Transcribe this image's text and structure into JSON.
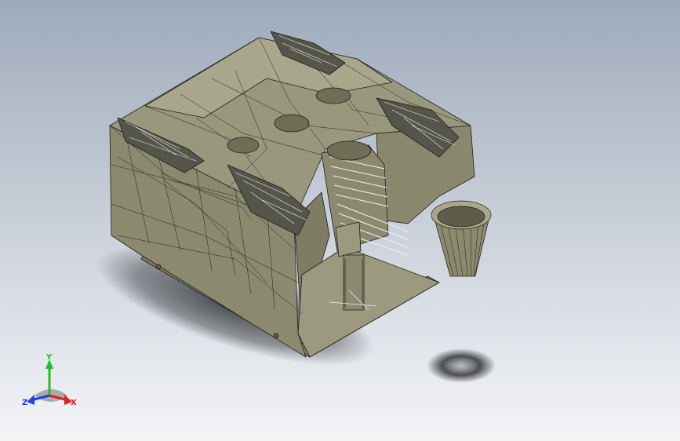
{
  "viewport": {
    "background_top": "#9eaabb",
    "background_bottom": "#f4f5f7",
    "model_color": "#8c8a6e",
    "model_dark": "#6f6d55",
    "model_light": "#a9a78b",
    "edge_color": "#1e1e1e",
    "shadow_color": "#2b2d30"
  },
  "triad": {
    "x_label": "X",
    "y_label": "Y",
    "z_label": "Z",
    "x_color": "#e02020",
    "y_color": "#20c020",
    "z_color": "#2040e0"
  }
}
